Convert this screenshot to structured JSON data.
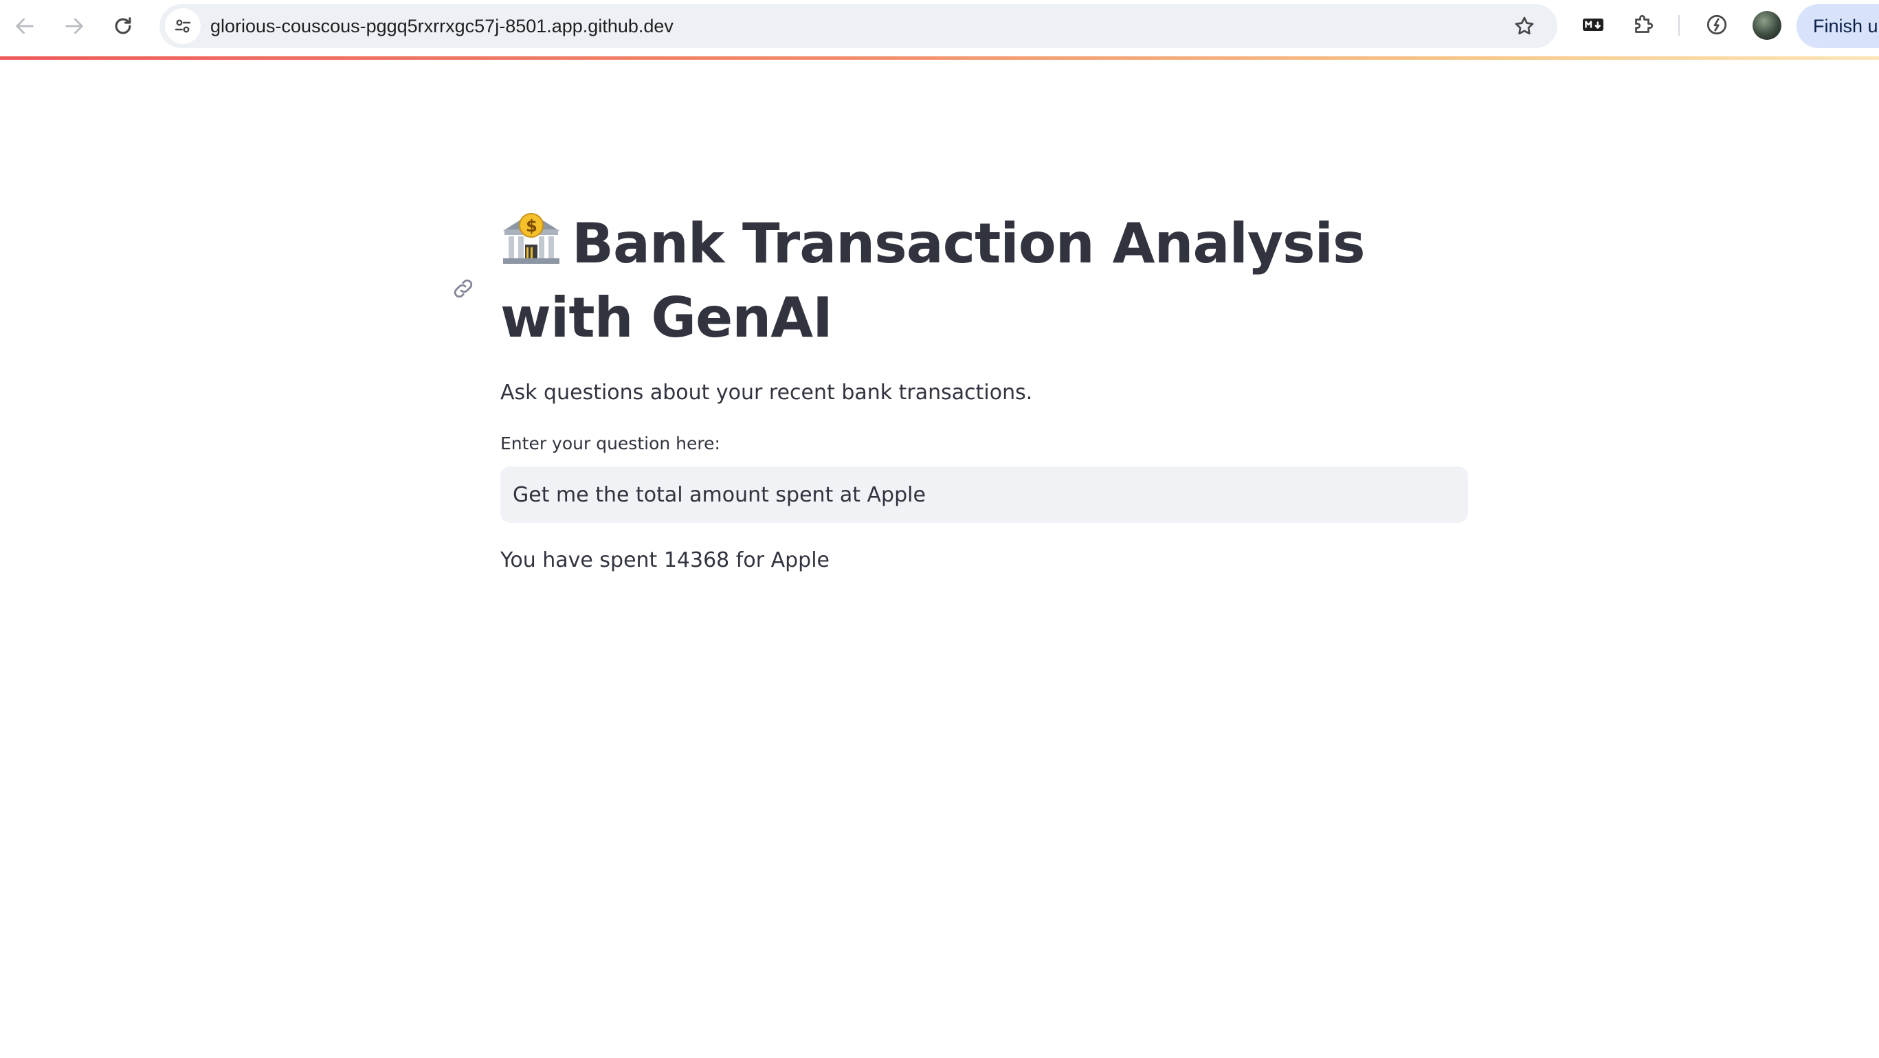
{
  "browser": {
    "url": "glorious-couscous-pggq5rxrrxgc57j-8501.app.github.dev",
    "finish_button_label": "Finish u",
    "icons": {
      "back": "back-arrow-icon",
      "forward": "forward-arrow-icon",
      "reload": "reload-icon",
      "site_info": "tune-icon",
      "bookmark": "star-icon",
      "markdown_ext": "markdown-icon",
      "extensions": "puzzle-icon",
      "performance": "speed-icon",
      "profile": "avatar"
    },
    "accent_colors": {
      "loading_bar_start": "#ee5a5a",
      "loading_bar_end": "#fbe5b8",
      "finish_button_bg": "#d8e3fb"
    }
  },
  "app": {
    "title": "Bank Transaction Analysis with GenAI",
    "title_icon": "bank-emoji-icon",
    "anchor_icon": "link-icon",
    "subtitle": "Ask questions about your recent bank transactions.",
    "question_label": "Enter your question here:",
    "question_value": "Get me the total amount spent at Apple",
    "answer": "You have spent 14368 for Apple",
    "text_color": "#31333f",
    "input_bg": "#f0f2f6"
  }
}
